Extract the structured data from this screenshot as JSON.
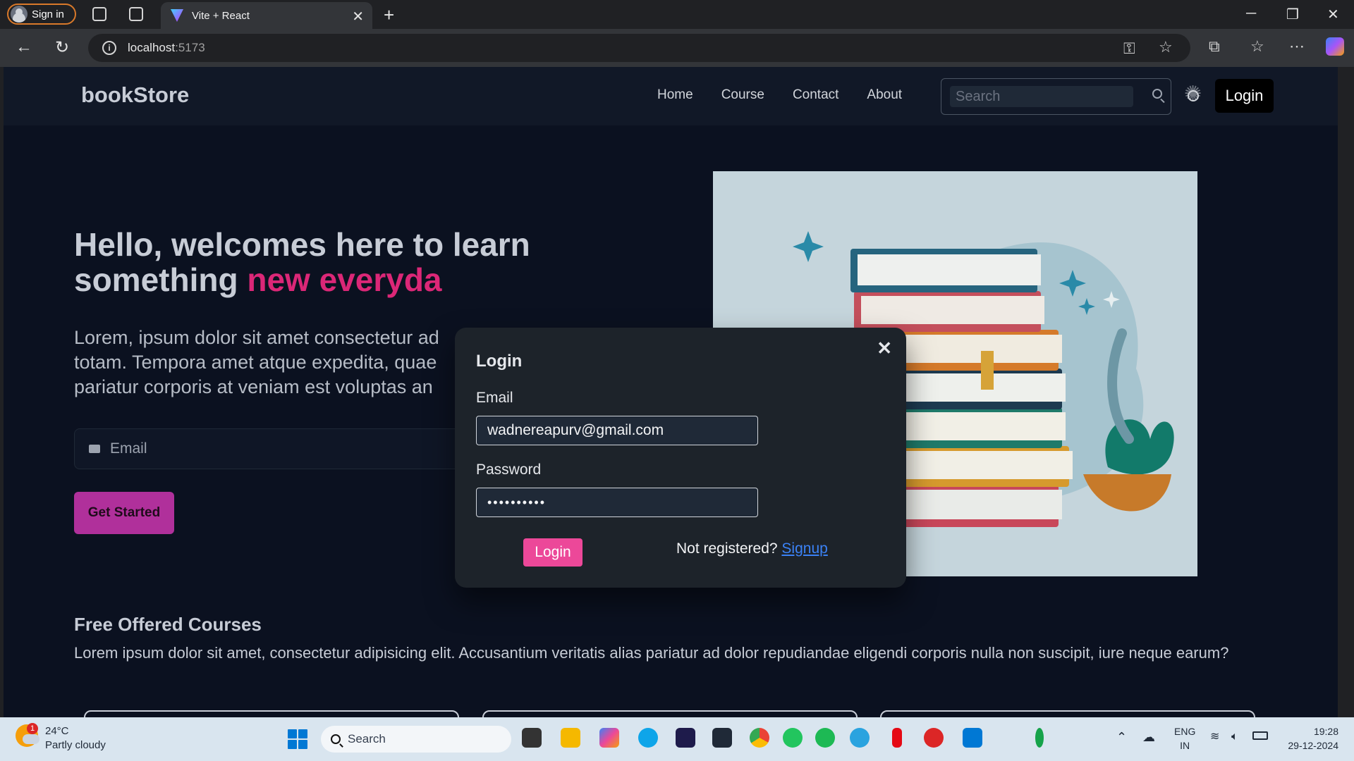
{
  "browser": {
    "sign_in_label": "Sign in",
    "tab_title": "Vite + React",
    "url_host": "localhost",
    "url_port": ":5173"
  },
  "navbar": {
    "brand": "bookStore",
    "links": [
      "Home",
      "Course",
      "Contact",
      "About"
    ],
    "search_placeholder": "Search",
    "login_label": "Login"
  },
  "hero": {
    "title_line1": "Hello, welcomes here to learn",
    "title_line2_start": "something ",
    "title_line2_highlight": "new everyda",
    "paragraph_line1": "Lorem, ipsum dolor sit amet consectetur ad",
    "paragraph_line2": "totam. Tempora amet atque expedita, quae",
    "paragraph_line3": "pariatur corporis at veniam est voluptas an",
    "email_placeholder": "Email",
    "cta_label": "Get Started"
  },
  "courses": {
    "title": "Free Offered Courses",
    "description": "Lorem ipsum dolor sit amet, consectetur adipisicing elit. Accusantium veritatis alias pariatur ad dolor repudiandae eligendi corporis nulla non suscipit, iure neque earum?"
  },
  "modal": {
    "title": "Login",
    "close_glyph": "✕",
    "email_label": "Email",
    "email_value": "wadnereapurv@gmail.com",
    "password_label": "Password",
    "password_value": "••••••••••",
    "submit_label": "Login",
    "register_prompt": "Not registered?",
    "register_link": "Signup"
  },
  "taskbar": {
    "weather_temp": "24°C",
    "weather_desc": "Partly cloudy",
    "weather_badge": "1",
    "search_label": "Search",
    "lang_top": "ENG",
    "lang_bottom": "IN",
    "time": "19:28",
    "date": "29-12-2024"
  },
  "colors": {
    "accent_pink": "#db2777",
    "modal_login_button": "#ec4899",
    "get_started_button": "#b0309b",
    "page_bg": "#0b1120"
  }
}
